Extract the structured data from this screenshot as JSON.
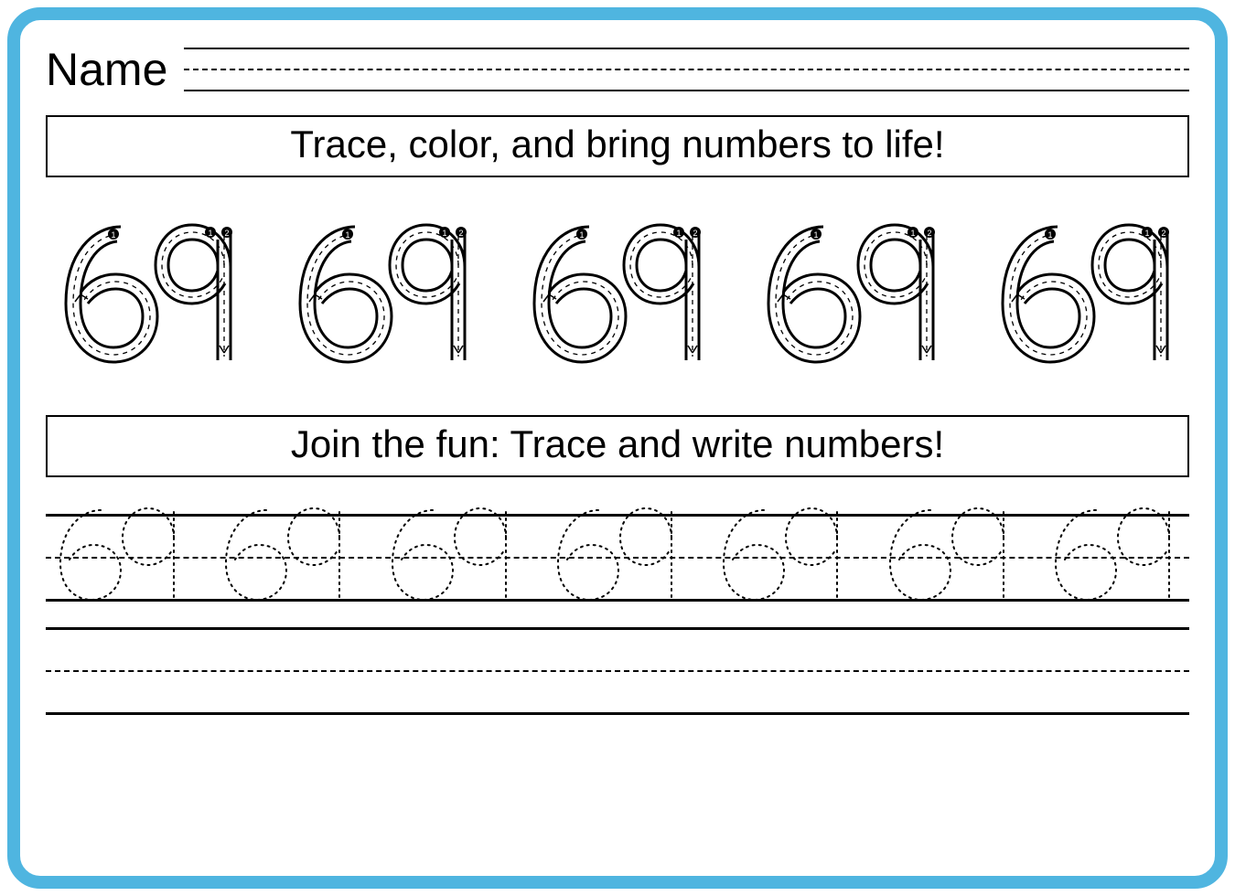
{
  "name_label": "Name",
  "instruction1": "Trace, color, and bring numbers to life!",
  "instruction2": "Join the fun: Trace and write numbers!",
  "number": "69",
  "big_trace_count": 5,
  "dotted_trace_count": 7,
  "colors": {
    "frame": "#4fb5e0",
    "ink": "#000000"
  }
}
